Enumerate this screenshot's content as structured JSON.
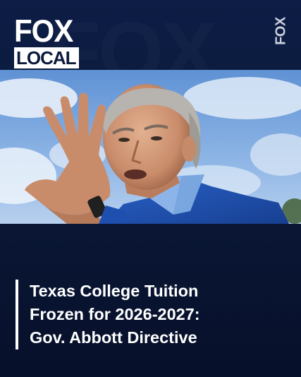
{
  "brand": {
    "logo_top": "FOX",
    "logo_bottom": "LOCAL",
    "vertical_mark": "FOX",
    "background_wordmark": "FOX"
  },
  "photo": {
    "subject": "man in blue blazer gesturing with raised hand against sky"
  },
  "headline": {
    "lines": [
      "Texas College Tuition",
      "Frozen for 2026-2027:",
      "Gov. Abbott Directive"
    ]
  },
  "colors": {
    "background": "#0c1a3e",
    "accent_text": "#ffffff",
    "sky": "#8fb6e6",
    "blazer": "#1f4fae"
  }
}
